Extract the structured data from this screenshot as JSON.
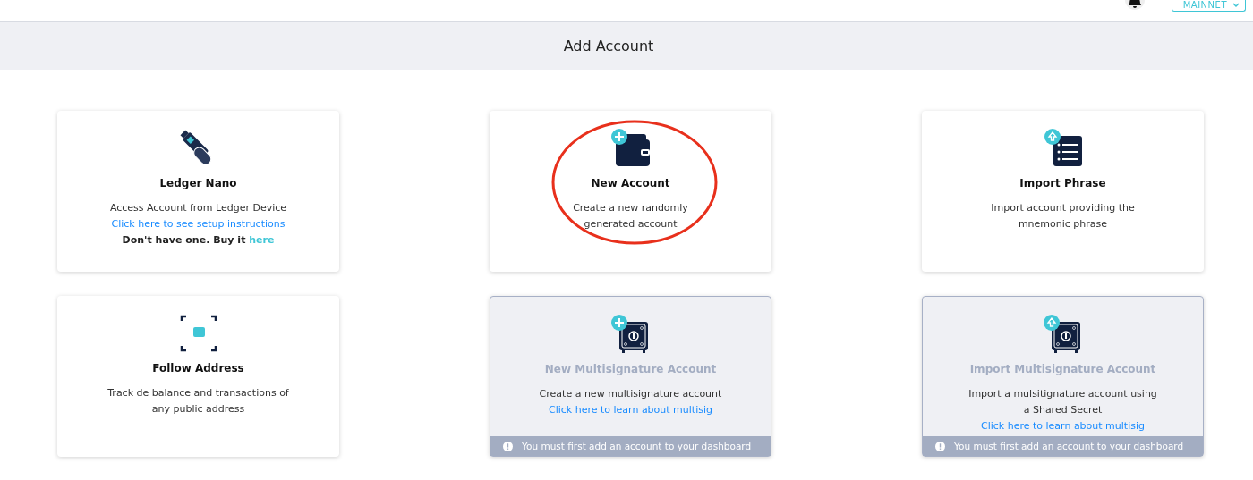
{
  "topbar": {
    "network": "MAINNET"
  },
  "header": {
    "title": "Add Account"
  },
  "cards": [
    {
      "title": "Ledger Nano",
      "disabled": false,
      "annotated": false,
      "description": "Access Account from Ledger Device",
      "link": "Click here to see setup instructions",
      "note": "Don't have one. Buy it",
      "note_link": "here"
    },
    {
      "title": "New Account",
      "disabled": false,
      "annotated": true,
      "description": "Create a new randomly generated account"
    },
    {
      "title": "Import Phrase",
      "disabled": false,
      "annotated": false,
      "description": "Import account providing the mnemonic phrase"
    },
    {
      "title": "Follow Address",
      "disabled": false,
      "annotated": false,
      "description": "Track de balance and transactions of any public address"
    },
    {
      "title": "New Multisignature Account",
      "disabled": true,
      "annotated": false,
      "description": "Create a new multisignature account",
      "link": "Click here to learn about multisig",
      "warning": "You must first add an account to your dashboard"
    },
    {
      "title": "Import Multisignature Account",
      "disabled": true,
      "annotated": false,
      "description": "Import a mulsitignature account using a Shared Secret",
      "link": "Click here to learn about multisig",
      "warning": "You must first add an account to your dashboard"
    }
  ]
}
